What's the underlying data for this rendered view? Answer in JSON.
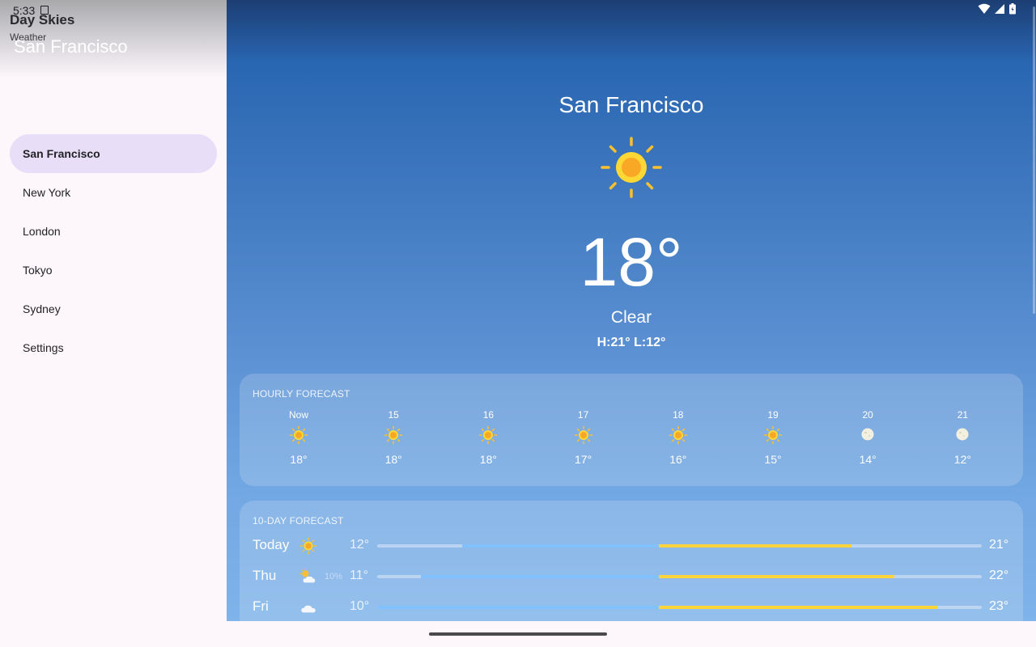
{
  "status_bar": {
    "time": "5:33"
  },
  "drawer": {
    "app_title": "Day Skies",
    "app_subtitle": "Weather",
    "header_city": "San Francisco",
    "items": [
      {
        "label": "San Francisco",
        "active": true
      },
      {
        "label": "New York"
      },
      {
        "label": "London"
      },
      {
        "label": "Tokyo"
      },
      {
        "label": "Sydney"
      },
      {
        "label": "Settings"
      }
    ]
  },
  "current": {
    "city": "San Francisco",
    "icon": "sun-icon",
    "temperature": "18°",
    "condition": "Clear",
    "high_low": "H:21° L:12°"
  },
  "hourly": {
    "title": "HOURLY FORECAST",
    "hours": [
      {
        "label": "Now",
        "icon": "sun-icon",
        "temp": "18°"
      },
      {
        "label": "15",
        "icon": "sun-icon",
        "temp": "18°"
      },
      {
        "label": "16",
        "icon": "sun-icon",
        "temp": "18°"
      },
      {
        "label": "17",
        "icon": "sun-icon",
        "temp": "17°"
      },
      {
        "label": "18",
        "icon": "sun-icon",
        "temp": "16°"
      },
      {
        "label": "19",
        "icon": "sun-icon",
        "temp": "15°"
      },
      {
        "label": "20",
        "icon": "moon-icon",
        "temp": "14°"
      },
      {
        "label": "21",
        "icon": "moon-icon",
        "temp": "12°"
      }
    ]
  },
  "daily": {
    "title": "10-DAY FORECAST",
    "days": [
      {
        "name": "Today",
        "icon": "sun-icon",
        "precip": "",
        "low": "12°",
        "high": "21°",
        "range_start": 0.14,
        "range_mid": 0.466,
        "range_end": 0.785
      },
      {
        "name": "Thu",
        "icon": "partly-cloudy-icon",
        "precip": "10%",
        "low": "11°",
        "high": "22°",
        "range_start": 0.072,
        "range_mid": 0.466,
        "range_end": 0.856
      },
      {
        "name": "Fri",
        "icon": "cloud-icon",
        "precip": "",
        "low": "10°",
        "high": "23°",
        "range_start": 0.0,
        "range_mid": 0.466,
        "range_end": 0.927
      }
    ]
  },
  "colors": {
    "sun": "#fbc02d",
    "sun_core": "#f9a825",
    "bar_cool": "#82c1ff",
    "bar_warm": "#ffd33a",
    "drawer_active": "#e8def8"
  }
}
